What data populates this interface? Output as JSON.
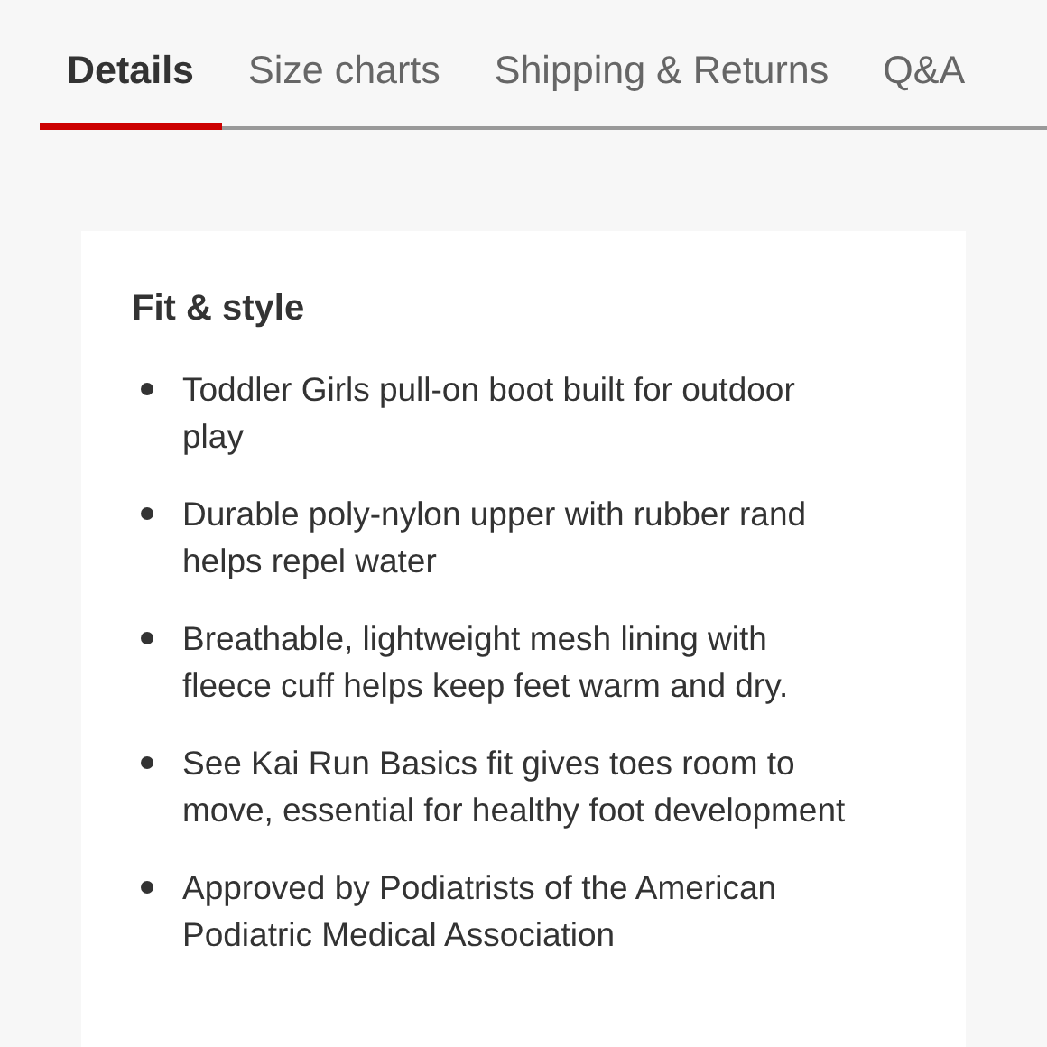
{
  "tabs": [
    {
      "label": "Details",
      "selected": true
    },
    {
      "label": "Size charts",
      "selected": false
    },
    {
      "label": "Shipping & Returns",
      "selected": false
    },
    {
      "label": "Q&A",
      "selected": false
    }
  ],
  "card": {
    "heading": "Fit & style",
    "bullets": [
      "Toddler Girls pull-on boot built for outdoor play",
      "Durable poly-nylon upper with rubber rand helps repel water",
      "Breathable, lightweight mesh lining with fleece cuff helps keep feet warm and dry.",
      "See Kai Run Basics fit gives toes room to move, essential for healthy foot development",
      "Approved by Podiatrists of the American Podiatric Medical Association"
    ]
  }
}
